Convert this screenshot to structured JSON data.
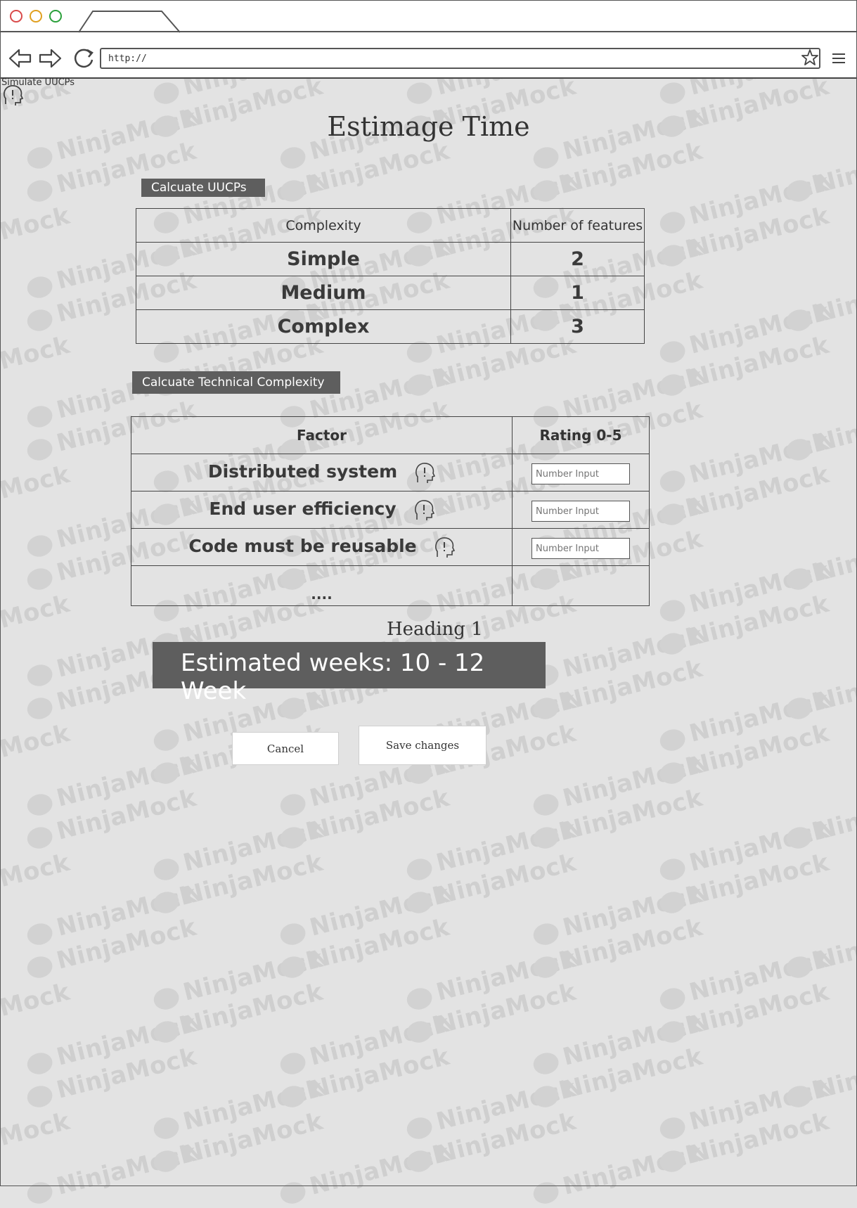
{
  "browser": {
    "url": "http://",
    "traffic_colors": [
      "#d94a4a",
      "#e0a020",
      "#2aa03a"
    ]
  },
  "watermark_text": "NinjaMock",
  "tooltip_label": "Simulate UUCPs",
  "page_title": "Estimage Time",
  "uucp_section": {
    "button_label": "Calcuate UUCPs",
    "headers": [
      "Complexity",
      "Number of features"
    ],
    "rows": [
      {
        "complexity": "Simple",
        "count": "2"
      },
      {
        "complexity": "Medium",
        "count": "1"
      },
      {
        "complexity": "Complex",
        "count": "3"
      }
    ]
  },
  "tc_section": {
    "button_label": "Calcuate Technical Complexity",
    "headers": [
      "Factor",
      "Rating 0-5"
    ],
    "rows": [
      {
        "factor": "Distributed system",
        "placeholder": "Number Input"
      },
      {
        "factor": "End user efficiency",
        "placeholder": "Number Input"
      },
      {
        "factor": "Code must be reusable",
        "placeholder": "Number Input"
      }
    ],
    "ellipsis": "...."
  },
  "heading1": "Heading 1",
  "estimate_text": "Estimated weeks: 10 - 12 Week",
  "actions": {
    "cancel": "Cancel",
    "save": "Save changes"
  }
}
